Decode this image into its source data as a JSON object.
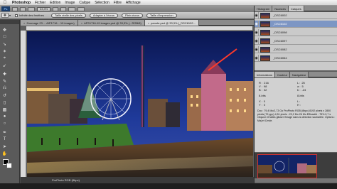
{
  "menubar": {
    "apple": "",
    "items": [
      "Photoshop",
      "Fichier",
      "Edition",
      "Image",
      "Calque",
      "Sélection",
      "Filtre",
      "Affichage"
    ]
  },
  "appbar": {
    "logo": "Ps",
    "zoom": "33,3%",
    "workspaces": [
      "APP2",
      "DVD",
      "Photographie"
    ],
    "active_workspace": "DVD",
    "cs_live": "CS Live"
  },
  "optbar": {
    "tool_icon": "move-icon",
    "checkbox_label": "Infinité des fenêtres",
    "buttons": [
      "Taille réelle des pixels",
      "Adapter à l'écran",
      "Plein écran",
      "Taille d'impression"
    ]
  },
  "document": {
    "tabs": [
      {
        "label": "Zoomage 23 ... AIP1716... 19 images)",
        "active": false
      },
      {
        "label": "AFS1716-19 images psd @ 33,3% (...RGB/8)",
        "active": false
      },
      {
        "label": "panobr.psd @ 33,3% (_DSC6102...",
        "active": true
      }
    ],
    "status": "ProPhoto RGB (8bpc)"
  },
  "panels": {
    "top_tabs": [
      "Histogram",
      "Nuances",
      "Calques"
    ],
    "active_top_tab": "Calques",
    "layers": [
      {
        "name": "_DSC6002",
        "visible": true,
        "active": false
      },
      {
        "name": "_DSC6102",
        "visible": true,
        "active": true
      },
      {
        "name": "_DSC6098",
        "visible": true,
        "active": false
      },
      {
        "name": "_DSC6097",
        "visible": true,
        "active": false
      },
      {
        "name": "_DSC6082",
        "visible": true,
        "active": false
      },
      {
        "name": "_DSC6064",
        "visible": true,
        "active": false
      }
    ],
    "info_tabs": [
      "Informations",
      "Couleur",
      "Navigateur"
    ],
    "active_info_tab": "Informations",
    "info_values": {
      "r": "R :",
      "r_val": "216",
      "g": "V :",
      "g_val": "98",
      "b": "B :",
      "b_val": "32",
      "x": "X :",
      "x_val": "0",
      "y": "Y :",
      "y_val": "0",
      "l": "L :",
      "l_val": "25",
      "a": "a :",
      "a_val": "5",
      "bb": "b :",
      "bb_val": "-24",
      "w": "L :",
      "h": "H :",
      "bits1": "8-bits",
      "bits2": "8-bits"
    },
    "info_text": "Doc : 79,4 Mo/1,73 Go ProPhoto RGB (8bpc) 8192 pixels x 2800 pixels (79 ppp) 4,51 pixels : 23,2 Mo 26 Mo Efficacité : 75% 0,7 s Cliquez et faites glisser l'image dans la direction souhaitée. Options : Maj et Cmde."
  }
}
